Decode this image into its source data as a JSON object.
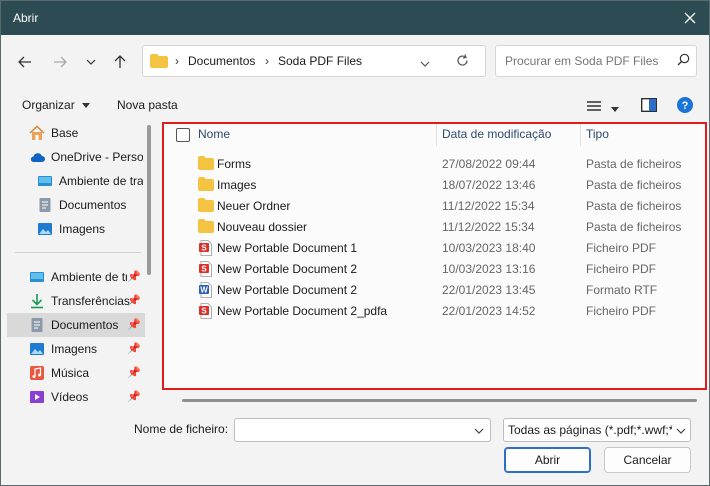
{
  "window": {
    "title": "Abrir"
  },
  "address": {
    "root": "Documentos",
    "current": "Soda PDF Files"
  },
  "search": {
    "placeholder": "Procurar em Soda PDF Files"
  },
  "toolbar": {
    "organize": "Organizar",
    "new_folder": "Nova pasta"
  },
  "sidebar": {
    "items": [
      {
        "label": "Base",
        "icon": "home-icon"
      },
      {
        "label": "OneDrive - Personal",
        "icon": "cloud-icon"
      },
      {
        "label": "Ambiente de trabalho",
        "icon": "desktop-icon"
      },
      {
        "label": "Documentos",
        "icon": "document-icon"
      },
      {
        "label": "Imagens",
        "icon": "pictures-icon"
      },
      {
        "label": "Ambiente de trabalho",
        "icon": "desktop-icon"
      },
      {
        "label": "Transferências",
        "icon": "download-icon"
      },
      {
        "label": "Documentos",
        "icon": "document-icon"
      },
      {
        "label": "Imagens",
        "icon": "pictures-icon"
      },
      {
        "label": "Música",
        "icon": "music-icon"
      },
      {
        "label": "Vídeos",
        "icon": "video-icon"
      }
    ]
  },
  "columns": {
    "name": "Nome",
    "date": "Data de modificação",
    "type": "Tipo"
  },
  "files": [
    {
      "name": "Forms",
      "date": "27/08/2022 09:44",
      "type": "Pasta de ficheiros",
      "kind": "folder"
    },
    {
      "name": "Images",
      "date": "18/07/2022 13:46",
      "type": "Pasta de ficheiros",
      "kind": "folder"
    },
    {
      "name": "Neuer Ordner",
      "date": "11/12/2022 15:34",
      "type": "Pasta de ficheiros",
      "kind": "folder"
    },
    {
      "name": "Nouveau dossier",
      "date": "11/12/2022 15:34",
      "type": "Pasta de ficheiros",
      "kind": "folder"
    },
    {
      "name": "New Portable Document 1",
      "date": "10/03/2023 18:40",
      "type": "Ficheiro PDF",
      "kind": "pdf"
    },
    {
      "name": "New Portable Document 2",
      "date": "10/03/2023 13:16",
      "type": "Ficheiro PDF",
      "kind": "pdf"
    },
    {
      "name": "New Portable Document 2",
      "date": "22/01/2023 13:45",
      "type": "Formato RTF",
      "kind": "rtf"
    },
    {
      "name": "New Portable Document 2_pdfa",
      "date": "22/01/2023 14:52",
      "type": "Ficheiro PDF",
      "kind": "pdf"
    }
  ],
  "footer": {
    "filename_label": "Nome de ficheiro:",
    "filename_value": "",
    "filter": "Todas as páginas (*.pdf;*.wwf;*.",
    "open": "Abrir",
    "cancel": "Cancelar"
  },
  "colors": {
    "titlebar": "#2d4b53",
    "selection_border": "#e01b1b",
    "folder": "#f5c342",
    "pdf": "#d9322b",
    "accent": "#2c6ec4"
  }
}
